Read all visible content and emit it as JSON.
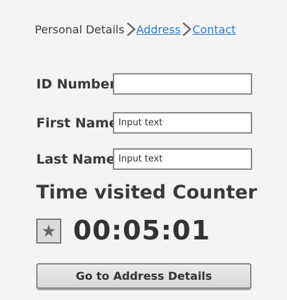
{
  "breadcrumb": {
    "current": "Personal Details",
    "links": [
      "Address",
      "Contact"
    ]
  },
  "form": {
    "id_number": {
      "label": "ID Number",
      "value": "",
      "placeholder": ""
    },
    "first_name": {
      "label": "First Name",
      "value": "",
      "placeholder": "Input text"
    },
    "last_name": {
      "label": "Last Name",
      "value": "",
      "placeholder": "Input text"
    }
  },
  "counter": {
    "title": "Time visited Counter",
    "icon": "star-icon",
    "time": "00:05:01"
  },
  "actions": {
    "next_label": "Go to Address Details"
  },
  "colors": {
    "link": "#2f7dc6",
    "text": "#3a3a3a",
    "background": "#f4f4f4"
  }
}
